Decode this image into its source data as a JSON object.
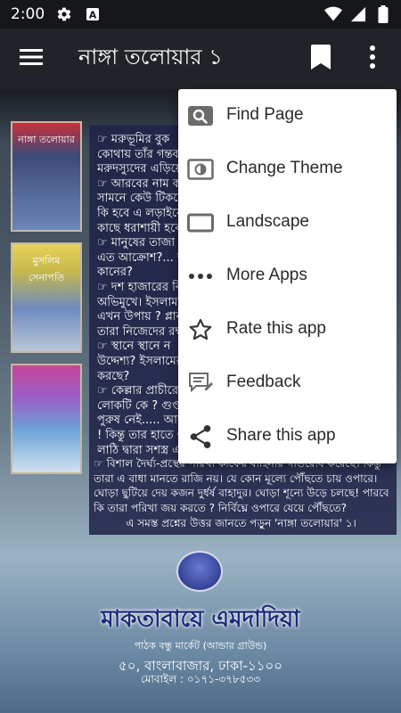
{
  "status_bar": {
    "time": "2:00",
    "icons": [
      "gear-icon",
      "text-badge-icon",
      "wifi-icon",
      "signal-icon",
      "battery-icon"
    ]
  },
  "app_bar": {
    "title": "নাঙ্গা তলোয়ার ১",
    "icons": [
      "hamburger-menu-icon",
      "bookmark-icon",
      "more-vert-icon"
    ]
  },
  "cover": {
    "thumbnails": [
      {
        "label": "নাঙ্গা তলোয়ার"
      },
      {
        "label": "মুসলিম সেনাপতি"
      },
      {
        "label": ""
      }
    ],
    "text_lines": [
      "☞ মরুভূমির বুক",
      "কোথায় তাঁর গন্তব্য?",
      "মরুদস্যুদের এড়িয়ে",
      "☞ আরবের নাম ক",
      "সামনে কেউ টিকতে",
      "কি হবে এ লড়াইয়ে",
      "কাছে ধরাশায়ী হবেন",
      "☞ মানুষের তাজা ক",
      "এত আক্রোশ?... আ",
      "কানের?",
      "☞ দশ হাজারের বি",
      "অভিমুখে। ইসলাম ও",
      "এখন উপায় ? প্লাবনে",
      "তারা নিজেদের রক্ষা ক",
      "☞ স্থানে স্থানে ন",
      "উদ্দেশ্য? ইসলামের বি",
      "করছে?",
      "☞ কেল্লার প্রাচীরে",
      "লোকটি কে ? গুপ্তচর",
      "পুরুষ নেই..... আরে",
      "! কিন্তু তার হাতে ও",
      "লাঠি দ্বারা সশস্ত্র এক",
      "☞ বিশাল দৈর্ঘ্য-প্রস্থের পরিখা কাফের বাহিনীর গতিরোধ করেছে। কিন্তু",
      "তারা এ বাধা মানতে রাজি নয়। যে কোন মূল্যে পৌঁছতে চায় ওপারে।",
      "ঘোড়া ছুটিয়ে দেয় কজন দুর্ধর্ষ বাহাদুর। ঘোড়া শূন্যে উড়ে চলছে! পারবে",
      "কি তারা পরিখা জয় করতে ? নির্বিঘ্নে ওপারে যেয়ে পৌঁছতে?",
      "এ সমস্ত প্রশ্নের উত্তর জানতে পড়ুন 'নাঙ্গা তলোয়ার' ১।"
    ],
    "publisher": "মাকতাবায়ে এমদাদিয়া",
    "publisher_sub": "পাঠক বন্ধু মার্কেট (আন্ডার গ্রাউন্ড)",
    "address": "৫০, বাংলাবাজার, ঢাকা-১১০০",
    "phone": "মোবাইল : ০১৭১-৩৭৮৫৩৩"
  },
  "menu": {
    "items": [
      {
        "label": "Find Page",
        "icon": "search-icon"
      },
      {
        "label": "Change Theme",
        "icon": "theme-icon"
      },
      {
        "label": "Landscape",
        "icon": "landscape-icon"
      },
      {
        "label": "More Apps",
        "icon": "more-horiz-icon"
      },
      {
        "label": "Rate this app",
        "icon": "star-outline-icon"
      },
      {
        "label": "Feedback",
        "icon": "feedback-icon"
      },
      {
        "label": "Share this app",
        "icon": "share-icon"
      }
    ]
  },
  "colors": {
    "app_bar": "#202428",
    "menu_bg": "#ffffff",
    "menu_text": "#2a2a2a",
    "icon_gray": "#6b6b6b"
  }
}
